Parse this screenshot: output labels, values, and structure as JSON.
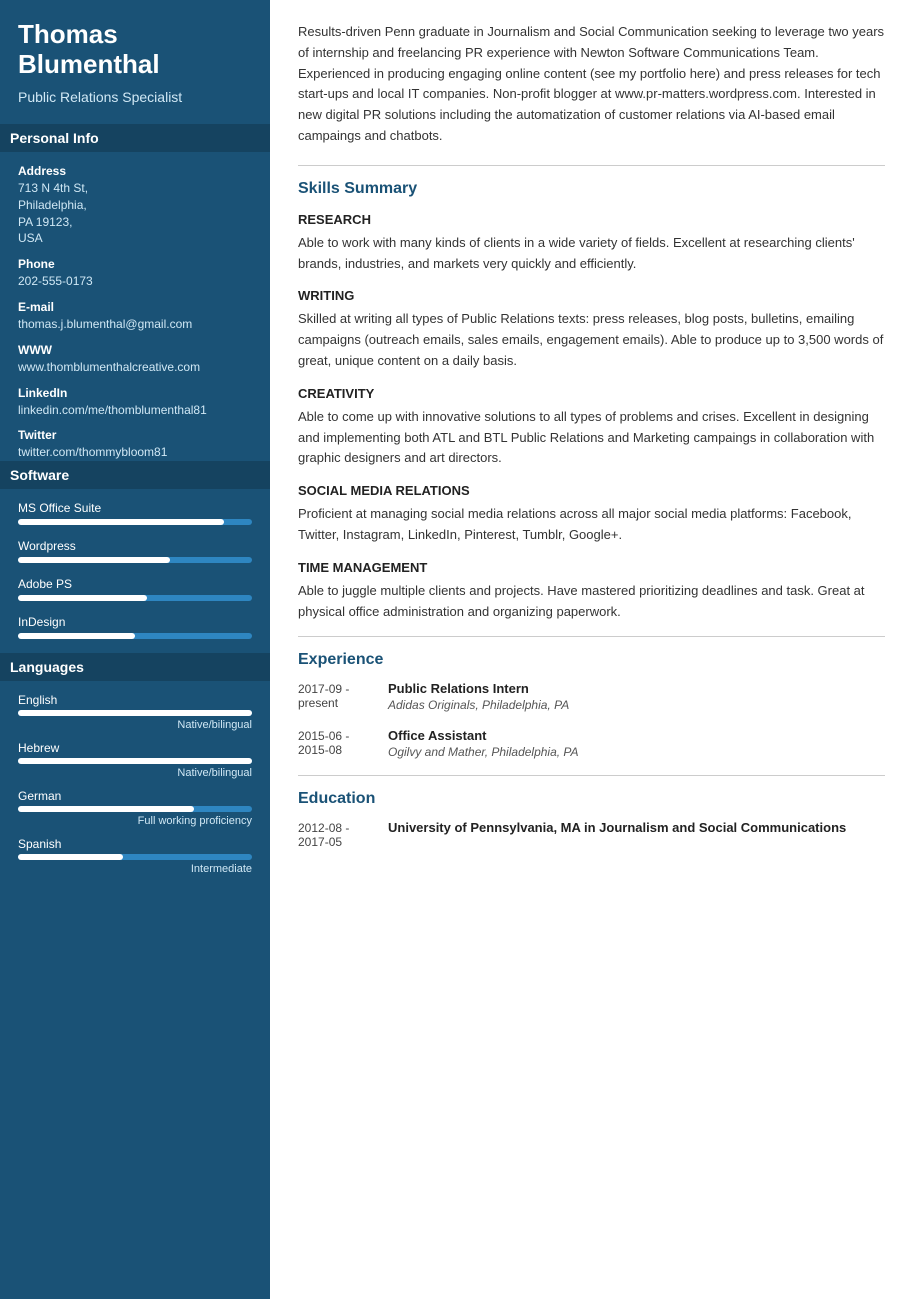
{
  "sidebar": {
    "name": "Thomas Blumenthal",
    "job_title": "Public Relations Specialist",
    "personal_info_header": "Personal Info",
    "address_label": "Address",
    "address_value": "713 N 4th St,\nPhiladelphia,\nPA 19123,\nUSA",
    "phone_label": "Phone",
    "phone_value": "202-555-0173",
    "email_label": "E-mail",
    "email_value": "thomas.j.blumenthal@gmail.com",
    "www_label": "WWW",
    "www_value": "www.thomblumenthalcreative.com",
    "linkedin_label": "LinkedIn",
    "linkedin_value": "linkedin.com/me/thomblumenthal81",
    "twitter_label": "Twitter",
    "twitter_value": "twitter.com/thommybloom81",
    "software_header": "Software",
    "software_items": [
      {
        "name": "MS Office Suite",
        "percent": 88
      },
      {
        "name": "Wordpress",
        "percent": 65
      },
      {
        "name": "Adobe PS",
        "percent": 55
      },
      {
        "name": "InDesign",
        "percent": 50
      }
    ],
    "languages_header": "Languages",
    "language_items": [
      {
        "name": "English",
        "percent": 100,
        "level": "Native/bilingual"
      },
      {
        "name": "Hebrew",
        "percent": 100,
        "level": "Native/bilingual"
      },
      {
        "name": "German",
        "percent": 75,
        "level": "Full working proficiency"
      },
      {
        "name": "Spanish",
        "percent": 45,
        "level": "Intermediate"
      }
    ]
  },
  "main": {
    "summary": "Results-driven Penn graduate in Journalism and Social Communication seeking to leverage two years of internship and freelancing PR experience with Newton Software Communications Team. Experienced in producing engaging online content (see my portfolio here) and press releases for tech start-ups and local IT companies. Non-profit blogger at www.pr-matters.wordpress.com. Interested in new digital PR solutions including the automatization of customer relations via AI-based email campaings and chatbots.",
    "skills_title": "Skills Summary",
    "skills": [
      {
        "category": "RESEARCH",
        "desc": "Able to work with many kinds of clients in a wide variety of fields. Excellent at researching clients' brands, industries, and markets very quickly and efficiently."
      },
      {
        "category": "WRITING",
        "desc": "Skilled at writing all types of Public Relations texts: press releases, blog posts, bulletins, emailing campaigns (outreach emails, sales emails, engagement emails). Able to produce up to 3,500 words of great, unique content on a daily basis."
      },
      {
        "category": "CREATIVITY",
        "desc": "Able to come up with innovative solutions to all types of problems and crises. Excellent in designing and implementing both ATL and BTL Public Relations and Marketing campaings in collaboration with graphic designers and art directors."
      },
      {
        "category": "SOCIAL MEDIA RELATIONS",
        "desc": "Proficient at managing social media relations across all major social media platforms: Facebook, Twitter, Instagram, LinkedIn, Pinterest, Tumblr, Google+."
      },
      {
        "category": "TIME MANAGEMENT",
        "desc": "Able to juggle multiple clients and projects. Have mastered prioritizing deadlines and task. Great at physical office administration and organizing paperwork."
      }
    ],
    "experience_title": "Experience",
    "experience_items": [
      {
        "date": "2017-09 -\npresent",
        "title": "Public Relations Intern",
        "company": "Adidas Originals, Philadelphia, PA"
      },
      {
        "date": "2015-06 -\n2015-08",
        "title": "Office Assistant",
        "company": "Ogilvy and Mather, Philadelphia, PA"
      }
    ],
    "education_title": "Education",
    "education_items": [
      {
        "date": "2012-08 -\n2017-05",
        "title": "University of Pennsylvania, MA in Journalism and Social Communications"
      }
    ]
  }
}
